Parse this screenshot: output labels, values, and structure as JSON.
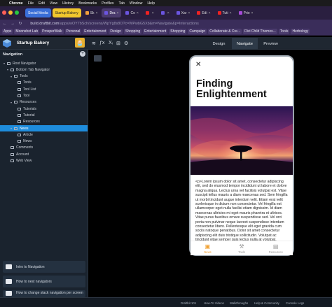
{
  "menubar": {
    "apple": "",
    "items": [
      "Chrome",
      "File",
      "Edit",
      "View",
      "History",
      "Bookmarks",
      "Profiles",
      "Tab",
      "Window",
      "Help"
    ]
  },
  "tabs": [
    {
      "label": "Social Media",
      "style": "pill-blue"
    },
    {
      "label": "Startup Bakery",
      "style": "pill-yellow"
    },
    {
      "label": "Sk",
      "style": "plain",
      "fav": "#f29f3c"
    },
    {
      "label": "Dra",
      "style": "active",
      "fav": "#6b55e0"
    },
    {
      "label": "Co",
      "style": "plain",
      "fav": "#6b55e0"
    },
    {
      "label": "",
      "style": "plain",
      "fav": "#e22"
    },
    {
      "label": "",
      "style": "plain",
      "fav": "#6b55e0"
    },
    {
      "label": "Xar",
      "style": "plain",
      "fav": "#6b55e0"
    },
    {
      "label": "Edi",
      "style": "plain",
      "fav": "#e22"
    },
    {
      "label": "Tuti",
      "style": "plain",
      "fav": "#e22"
    },
    {
      "label": "Prio",
      "style": "plain",
      "fav": "#a64ad8"
    }
  ],
  "address": {
    "url_host": "build.draftbit.com",
    "url_path": "/apps/wOY7bSch/screens/WpYg8s8O?c=WPwbG5Xb&m=Navigate&p=Interactions"
  },
  "bookmarks": [
    "Apps",
    "Moonshot Lab",
    "ProsperWalk",
    "Personal",
    "Entertainment",
    "Design",
    "Shopping",
    "Entertainment",
    "Shopping",
    "Campaign",
    "Collaborate & Cre...",
    "Divi Child Themes...",
    "Tools",
    "Herbology"
  ],
  "app": {
    "name": "Startup Bakery",
    "avatar": "🧁",
    "tools": [
      "≋",
      "ƒx",
      "Xᵢ",
      "⊞",
      "⚙"
    ],
    "mode_tabs": [
      "Design",
      "Navigate",
      "Preview"
    ],
    "active_mode": "Navigate"
  },
  "sidebar": {
    "title": "Navigation",
    "add": "+",
    "tree": [
      {
        "label": "Root Navigator",
        "depth": 0,
        "caret": "▾"
      },
      {
        "label": "Bottom Tab Navigator",
        "depth": 1,
        "caret": "▾"
      },
      {
        "label": "Tools",
        "depth": 2,
        "caret": "▾"
      },
      {
        "label": "Tools",
        "depth": 3,
        "caret": ""
      },
      {
        "label": "Tool List",
        "depth": 3,
        "caret": ""
      },
      {
        "label": "Tool",
        "depth": 3,
        "caret": ""
      },
      {
        "label": "Resources",
        "depth": 2,
        "caret": "▾"
      },
      {
        "label": "Tutorials",
        "depth": 3,
        "caret": ""
      },
      {
        "label": "Tutorial",
        "depth": 3,
        "caret": ""
      },
      {
        "label": "Resources",
        "depth": 3,
        "caret": ""
      },
      {
        "label": "News",
        "depth": 2,
        "caret": "▾",
        "selected": true
      },
      {
        "label": "Article",
        "depth": 3,
        "caret": ""
      },
      {
        "label": "News",
        "depth": 3,
        "caret": ""
      },
      {
        "label": "Comments",
        "depth": 1,
        "caret": ""
      },
      {
        "label": "Account",
        "depth": 1,
        "caret": ""
      },
      {
        "label": "Web View",
        "depth": 1,
        "caret": ""
      }
    ],
    "tutorials": [
      "Intro to Navigation",
      "How to nest navigators",
      "How to change stack navigation per screen"
    ]
  },
  "phone": {
    "close": "✕",
    "title": "Finding Enlightenment",
    "body": "<p>Lorem ipsum dolor sit amet, consectetur adipiscing elit, sed do eiusmod tempor incididunt ut labore et dolore magna aliqua. Lectus urna vel facilisis volutpat est. Vitae suscipit tellus mauris a diam maecenas sed. Sem fringilla ut morbi tincidunt augue interdum velit. Etiam erat velit scelerisque in dictum non consectetur. Vel fringilla est ullamcorper eget nulla facilisi etiam dignissim. Id diam maecenas ultricies mi eget mauris pharetra et ultrices. Vitae purus faucibus ornare suspendisse sed. Vel orci porta non pulvinar neque laoreet suspendisse interdum consectetur libero. Pellentesque elit eget gravida cum sociis natoque penatibus. Dolor sit amet consectetur adipiscing elit duis tristique sollicitudin. Volutpat ac tincidunt vitae semper quis lectus nulla at volutpat.",
    "tabs": [
      {
        "label": "News",
        "glyph": "▣",
        "active": true
      },
      {
        "label": "Tools",
        "glyph": "⚒",
        "active": false
      },
      {
        "label": "Resources",
        "glyph": "▤",
        "active": false
      }
    ]
  },
  "footer": [
    "Draftbit 101",
    "How-To Videos",
    "Walkthroughs",
    "Help & Community",
    "Console Logs"
  ]
}
